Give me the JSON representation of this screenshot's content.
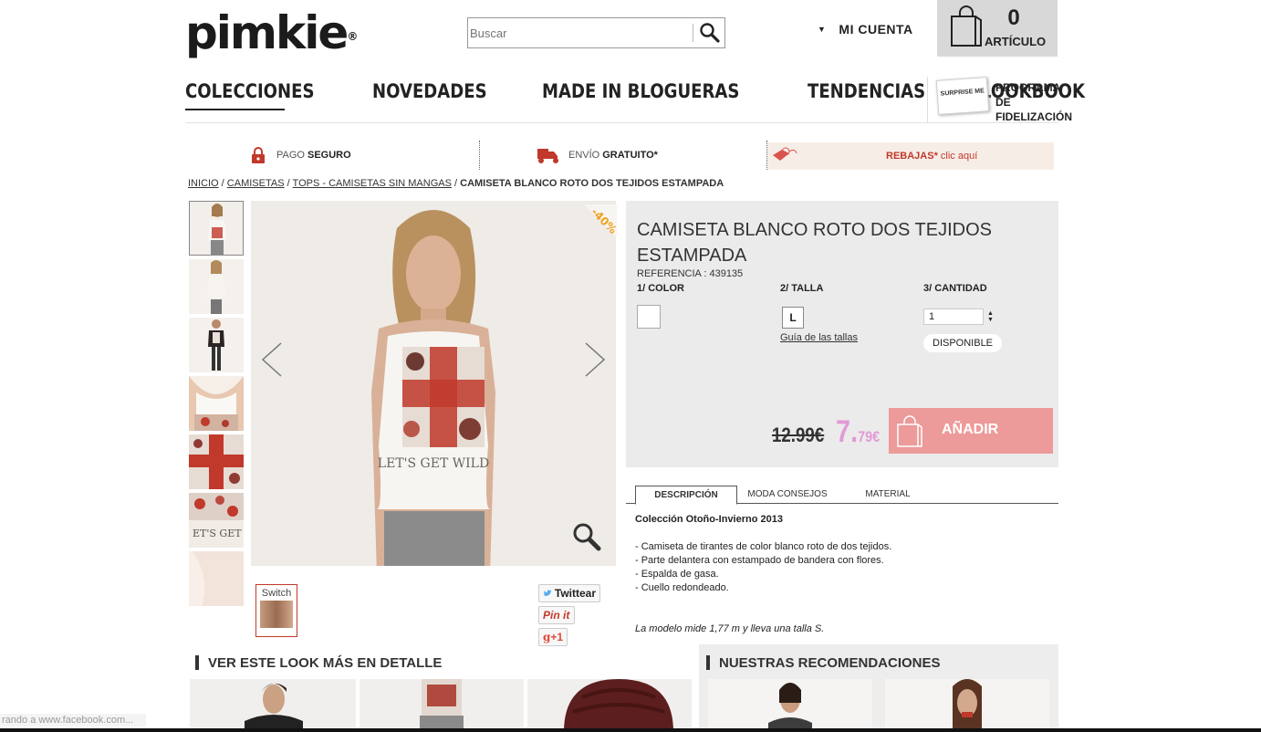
{
  "header": {
    "logo": "pimkie",
    "logo_mark": "®",
    "search_placeholder": "Buscar",
    "account": "MI CUENTA",
    "cart_count": "0",
    "cart_label": "ARTÍCULO"
  },
  "nav": {
    "items": [
      "COLECCIONES",
      "NOVEDADES",
      "MADE IN BLOGUERAS",
      "TENDENCIAS",
      "LOOKBOOK"
    ],
    "active": "COLECCIONES",
    "loyalty_card": "SURPRISE ME",
    "loyalty_line1": "PROGRAMA DE",
    "loyalty_line2": "FIDELIZACIÓN"
  },
  "infobar": {
    "pago_a": "PAGO",
    "pago_b": "SEGURO",
    "envio_a": "ENVÍO",
    "envio_b": "GRATUITO*",
    "rebajas_a": "REBAJAS*",
    "rebajas_b": "clic aquí"
  },
  "breadcrumb": {
    "l1": "INICIO",
    "l2": "CAMISETAS",
    "l3": "TOPS - CAMISETAS SIN MANGAS",
    "sep": " / ",
    "current": "CAMISETA BLANCO ROTO DOS TEJIDOS ESTAMPADA"
  },
  "gallery": {
    "badge": "-40%",
    "print_text": "LET'S GET WILD",
    "switch_label": "Switch"
  },
  "social": {
    "twitter": "Twittear",
    "pinterest": "Pin it",
    "gplus": "+1"
  },
  "product": {
    "title": "CAMISETA BLANCO ROTO DOS TEJIDOS ESTAMPADA",
    "reference": "REFERENCIA : 439135",
    "step1": "1/ COLOR",
    "step2": "2/ TALLA",
    "step3": "3/ CANTIDAD",
    "size": "L",
    "size_guide": "Guía de las tallas",
    "quantity": "1",
    "availability": "DISPONIBLE",
    "old_price": "12.99€",
    "new_price_int": "7.",
    "new_price_dec": "79€",
    "add_button": "AÑADIR"
  },
  "tabs": [
    "DESCRIPCIÓN",
    "MODA CONSEJOS",
    "MATERIAL"
  ],
  "description": {
    "heading": "Colección Otoño-Invierno 2013",
    "bullets": [
      "- Camiseta de tirantes de color blanco roto de dos tejidos.",
      "- Parte delantera con estampado de bandera con flores.",
      "- Espalda de gasa.",
      "- Cuello redondeado."
    ],
    "model": "La modelo mide 1,77 m y lleva una talla S."
  },
  "sections": {
    "look": "VER ESTE LOOK MÁS EN DETALLE",
    "reco": "NUESTRAS RECOMENDACIONES"
  },
  "status_bar": "rando a www.facebook.com..."
}
